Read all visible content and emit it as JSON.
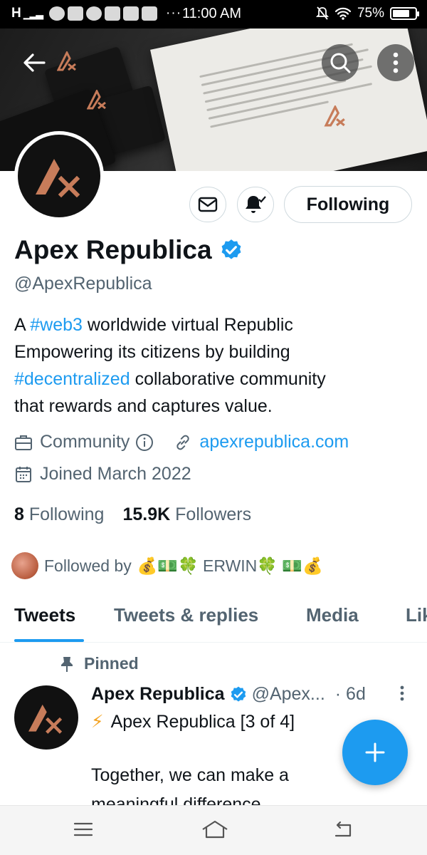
{
  "status_bar": {
    "signal": "H",
    "time": "11:00 AM",
    "battery": "75%",
    "battery_level": 0.75,
    "overflow": "···"
  },
  "profile": {
    "name": "Apex Republica",
    "handle": "@ApexRepublica",
    "following_button": "Following",
    "bio": {
      "l1_pre": "A ",
      "l1_tag": "#web3",
      "l1_post": " worldwide virtual Republic",
      "l2": "Empowering its citizens by building",
      "l3_tag": "#decentralized",
      "l3_post": " collaborative community",
      "l4": "that rewards and captures value."
    },
    "category": "Community",
    "website": "apexrepublica.com",
    "joined": "Joined March 2022",
    "following_count": "8",
    "following_label": "Following",
    "followers_count": "15.9K",
    "followers_label": "Followers",
    "followed_by_label": "Followed by",
    "followed_by_name": "💰💵🍀 ERWIN🍀 💵💰"
  },
  "tabs": [
    "Tweets",
    "Tweets & replies",
    "Media",
    "Likes"
  ],
  "tweet": {
    "pinned_label": "Pinned",
    "author": "Apex Republica",
    "handle": "@Apex...",
    "time": "· 6d",
    "emoji": "⚡",
    "line1": "Apex Republica [3 of 4]",
    "line2": "Together, we can make a",
    "line3": "meaningful difference."
  },
  "colors": {
    "accent": "#1d9bf0",
    "muted": "#536471",
    "text": "#0f1419",
    "logo": "#c77c5a"
  },
  "icons": {
    "back": "arrow-left-icon",
    "search": "search-icon",
    "more": "more-vertical-icon",
    "message": "envelope-icon",
    "notify": "bell-check-icon",
    "verified": "verified-badge-icon",
    "category": "briefcase-icon",
    "info": "info-icon",
    "link": "link-icon",
    "calendar": "calendar-icon",
    "pin": "pin-icon",
    "compose": "plus-icon"
  }
}
